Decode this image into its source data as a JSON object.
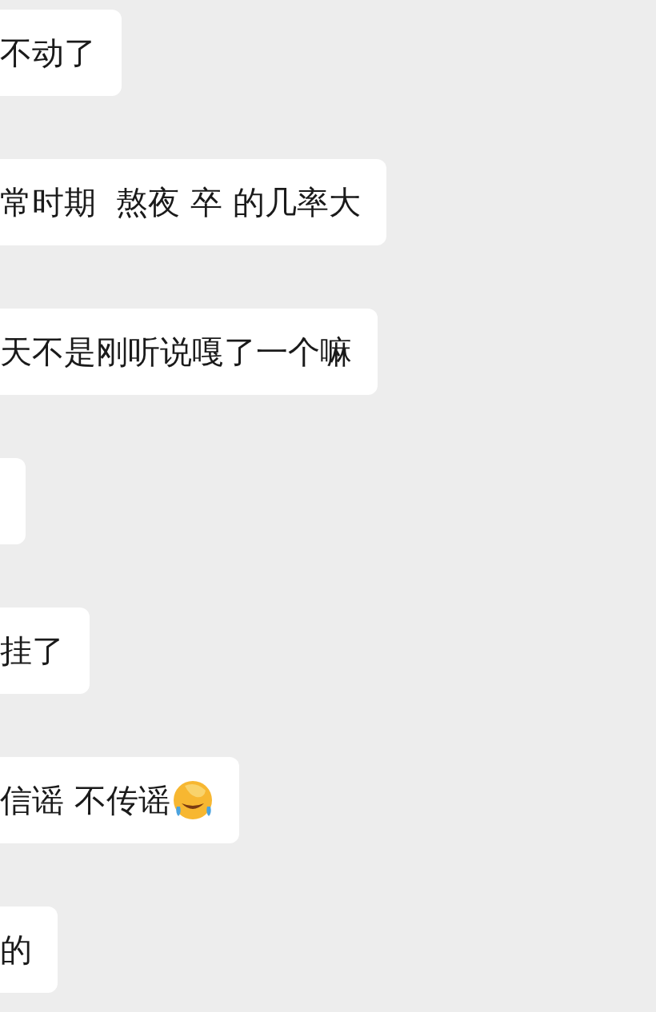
{
  "messages": [
    {
      "text": "不动了",
      "emoji": false
    },
    {
      "text": "常时期  熬夜 卒 的几率大",
      "emoji": false
    },
    {
      "text": "天不是刚听说嘎了一个嘛",
      "emoji": false
    },
    {
      "emoji": false
    },
    {
      "text": "挂了",
      "emoji": false
    },
    {
      "text": "信谣 不传谣",
      "emoji": true
    },
    {
      "text": "的",
      "emoji": false
    }
  ]
}
